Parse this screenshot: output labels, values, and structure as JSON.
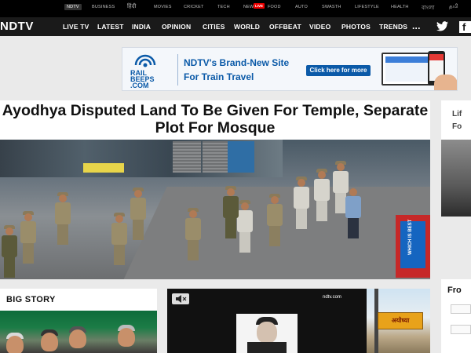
{
  "top_links": [
    {
      "label": "NDTV",
      "active": true
    },
    {
      "label": "BUSINESS"
    },
    {
      "label": "हिंदी"
    },
    {
      "label": "MOVIES"
    },
    {
      "label": "CRICKET"
    },
    {
      "label": "TECH"
    },
    {
      "label": "NEW"
    },
    {
      "label": "FOOD"
    },
    {
      "label": "AUTO"
    },
    {
      "label": "SWASTH"
    },
    {
      "label": "LIFESTYLE"
    },
    {
      "label": "HEALTH"
    },
    {
      "label": "বাংলা"
    },
    {
      "label": "தமி"
    }
  ],
  "live_badge": "LIVE",
  "logo": "NDTV",
  "nav": [
    "LIVE TV",
    "LATEST",
    "INDIA",
    "OPINION",
    "CITIES",
    "WORLD",
    "OFFBEAT",
    "VIDEO",
    "PHOTOS",
    "TRENDS"
  ],
  "nav_more": "...",
  "ad": {
    "brand_line1": "RAIL",
    "brand_line2": "BEEPS",
    "brand_line3": ".COM",
    "headline": "NDTV's Brand-New Site",
    "subline": "For Train Travel",
    "button": "Click here for more"
  },
  "headline": "Ayodhya Disputed Land To Be Given For Temple, Separate Plot For Mosque",
  "hero_sign": "WHICH IS BEST",
  "big_story": {
    "label": "BIG STORY"
  },
  "video": {
    "watermark": "ndtv.com"
  },
  "side_photo_sign": "अयोध्या",
  "right_peek": {
    "line1": "Lif",
    "line2": "Fo",
    "title": "Fro"
  },
  "colors": {
    "topbar": "#000000",
    "nav": "#1a1a1a",
    "ad_blue": "#0b5aa8",
    "live": "#ee0000"
  }
}
